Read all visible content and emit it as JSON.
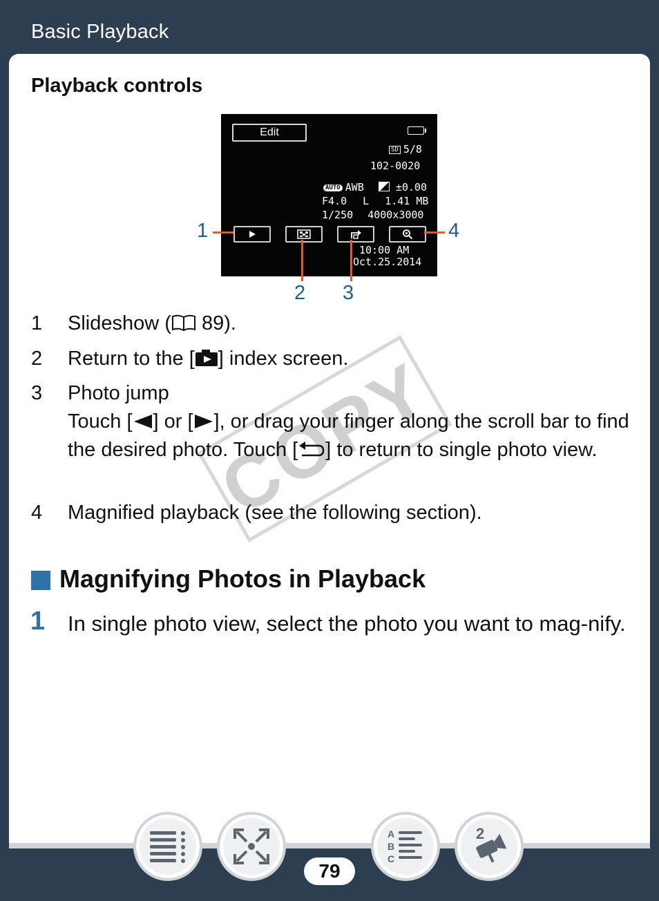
{
  "header": {
    "title": "Basic Playback"
  },
  "section": {
    "heading": "Playback controls"
  },
  "screen": {
    "edit_label": "Edit",
    "counter": "5/8",
    "file_number": "102-0020",
    "auto_badge": "AUTO",
    "awb": "AWB",
    "exposure": "±0.00",
    "aperture": "F4.0",
    "quality": "L",
    "file_size": "1.41 MB",
    "shutter": "1/250",
    "resolution": "4000x3000",
    "time": "10:00 AM",
    "date": "Oct.25.2014",
    "card_badge": "SD"
  },
  "callouts": {
    "c1": "1",
    "c2": "2",
    "c3": "3",
    "c4": "4"
  },
  "items": [
    {
      "num": "1",
      "text_a": "Slideshow (",
      "text_b": " 89)."
    },
    {
      "num": "2",
      "text_a": "Return to the [",
      "text_b": "] index screen."
    },
    {
      "num": "3",
      "title": "Photo jump",
      "line_a": "Touch [",
      "line_b": "] or [",
      "line_c": "], or drag your finger along the scroll bar to find the desired photo. Touch [",
      "line_d": "] to return to single photo view."
    },
    {
      "num": "4",
      "text": "Magnified playback (see the following section)."
    }
  ],
  "watermark": "COPY",
  "subheading": "Magnifying Photos in Playback",
  "step": {
    "num": "1",
    "text": "In single photo view, select the photo you want to mag-nify."
  },
  "footer": {
    "page_number": "79"
  },
  "nav": {
    "contents_icon": "table-of-contents-icon",
    "search_icon": "fit-to-screen-icon",
    "index_icon": "abc-index-icon",
    "mode_icon": "camera-mode-icon",
    "mode_label": "2"
  },
  "colors": {
    "header_bg": "#2d3e50",
    "accent_blue": "#2e72a8",
    "callout_blue": "#1f5f8c",
    "leader_orange": "#e05a2a"
  }
}
